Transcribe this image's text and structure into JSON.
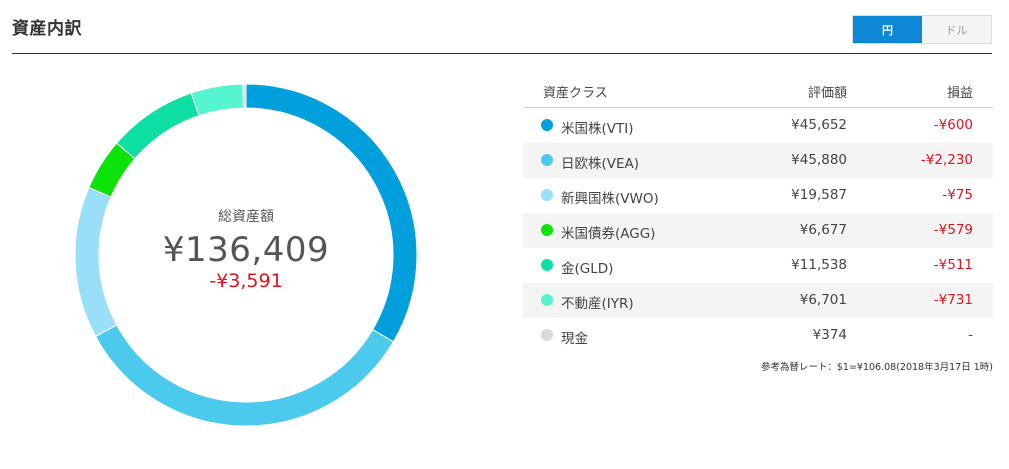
{
  "header": {
    "title": "資産内訳",
    "currency_toggle": [
      {
        "label": "円",
        "active": true
      },
      {
        "label": "ドル",
        "active": false
      }
    ]
  },
  "summary": {
    "label": "総資産額",
    "total": "¥136,409",
    "profit_loss": "-¥3,591"
  },
  "table": {
    "columns": [
      "資産クラス",
      "評価額",
      "損益"
    ],
    "rows": [
      {
        "name": "米国株(VTI)",
        "value": "¥45,652",
        "pl": "-¥600",
        "color": "#019fdc",
        "amount": 45652
      },
      {
        "name": "日欧株(VEA)",
        "value": "¥45,880",
        "pl": "-¥2,230",
        "color": "#4ccaee",
        "amount": 45880
      },
      {
        "name": "新興国株(VWO)",
        "value": "¥19,587",
        "pl": "-¥75",
        "color": "#99dff9",
        "amount": 19587
      },
      {
        "name": "米国債券(AGG)",
        "value": "¥6,677",
        "pl": "-¥579",
        "color": "#0be30b",
        "amount": 6677
      },
      {
        "name": "金(GLD)",
        "value": "¥11,538",
        "pl": "-¥511",
        "color": "#0ee0a5",
        "amount": 11538
      },
      {
        "name": "不動産(IYR)",
        "value": "¥6,701",
        "pl": "-¥731",
        "color": "#55f5d2",
        "amount": 6701
      },
      {
        "name": "現金",
        "value": "¥374",
        "pl": "-",
        "color": "#d9d9d9",
        "amount": 374
      }
    ]
  },
  "footnote": "参考為替レート：$1=¥106.08(2018年3月17日 1時)",
  "colors": {
    "accent": "#0e87d6",
    "loss": "#e0141e"
  }
}
